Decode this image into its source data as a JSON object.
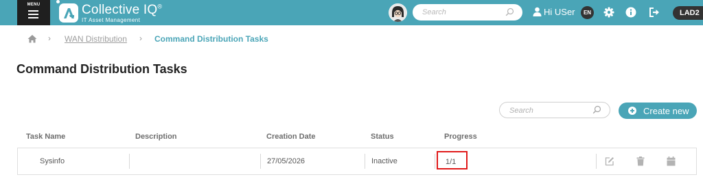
{
  "header": {
    "menu_label": "MENU",
    "app_title": "Collective IQ",
    "app_title_mark": "®",
    "app_subtitle": "IT Asset Management",
    "search_placeholder": "Search",
    "user_greeting": "Hi USer",
    "language": "EN",
    "tenant": "LAD2",
    "accent_color": "#4aa5b7"
  },
  "breadcrumb": {
    "items": [
      "WAN Distribution",
      "Command Distribution Tasks"
    ]
  },
  "page": {
    "title": "Command Distribution Tasks"
  },
  "toolbar": {
    "search_placeholder": "Search",
    "create_label": "Create new"
  },
  "table": {
    "columns": [
      "Task Name",
      "Description",
      "Creation Date",
      "Status",
      "Progress"
    ],
    "rows": [
      {
        "task_name": "Sysinfo",
        "description": "",
        "creation_date": "27/05/2026",
        "status": "Inactive",
        "progress": "1/1",
        "actions": [
          "edit-icon",
          "trash-icon",
          "calendar-icon"
        ]
      }
    ]
  },
  "icons": [
    "menu-icon",
    "logo-icon",
    "avatar",
    "search-icon",
    "user-icon",
    "gear-icon",
    "info-icon",
    "logout-icon",
    "home-icon",
    "chevron-right-icon",
    "plus-circle-icon",
    "edit-icon",
    "trash-icon",
    "calendar-icon"
  ]
}
